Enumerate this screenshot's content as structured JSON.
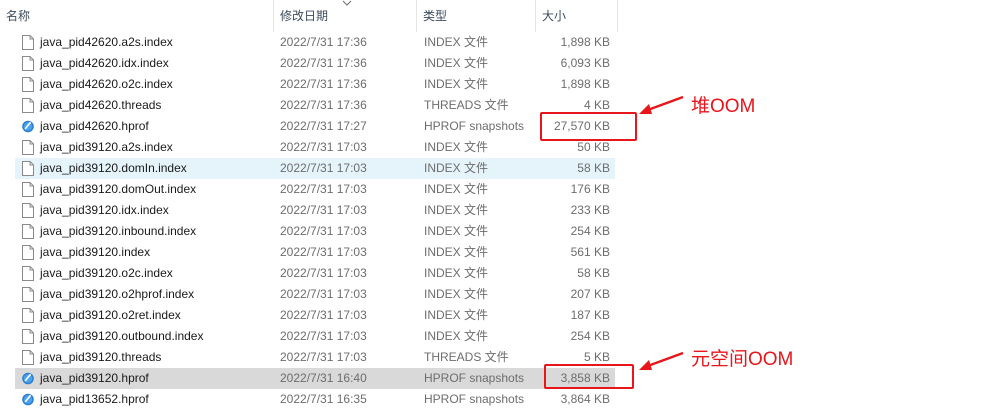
{
  "columns": {
    "name": "名称",
    "date": "修改日期",
    "type": "类型",
    "size": "大小"
  },
  "files": [
    {
      "name": "java_pid42620.a2s.index",
      "date": "2022/7/31 17:36",
      "type": "INDEX 文件",
      "size": "1,898 KB",
      "icon": "file-icon"
    },
    {
      "name": "java_pid42620.idx.index",
      "date": "2022/7/31 17:36",
      "type": "INDEX 文件",
      "size": "6,093 KB",
      "icon": "file-icon"
    },
    {
      "name": "java_pid42620.o2c.index",
      "date": "2022/7/31 17:36",
      "type": "INDEX 文件",
      "size": "1,898 KB",
      "icon": "file-icon"
    },
    {
      "name": "java_pid42620.threads",
      "date": "2022/7/31 17:36",
      "type": "THREADS 文件",
      "size": "4 KB",
      "icon": "file-icon"
    },
    {
      "name": "java_pid42620.hprof",
      "date": "2022/7/31 17:27",
      "type": "HPROF snapshots",
      "size": "27,570 KB",
      "icon": "hprof-icon"
    },
    {
      "name": "java_pid39120.a2s.index",
      "date": "2022/7/31 17:03",
      "type": "INDEX 文件",
      "size": "50 KB",
      "icon": "file-icon"
    },
    {
      "name": "java_pid39120.domIn.index",
      "date": "2022/7/31 17:03",
      "type": "INDEX 文件",
      "size": "58 KB",
      "icon": "file-icon"
    },
    {
      "name": "java_pid39120.domOut.index",
      "date": "2022/7/31 17:03",
      "type": "INDEX 文件",
      "size": "176 KB",
      "icon": "file-icon"
    },
    {
      "name": "java_pid39120.idx.index",
      "date": "2022/7/31 17:03",
      "type": "INDEX 文件",
      "size": "233 KB",
      "icon": "file-icon"
    },
    {
      "name": "java_pid39120.inbound.index",
      "date": "2022/7/31 17:03",
      "type": "INDEX 文件",
      "size": "254 KB",
      "icon": "file-icon"
    },
    {
      "name": "java_pid39120.index",
      "date": "2022/7/31 17:03",
      "type": "INDEX 文件",
      "size": "561 KB",
      "icon": "file-icon"
    },
    {
      "name": "java_pid39120.o2c.index",
      "date": "2022/7/31 17:03",
      "type": "INDEX 文件",
      "size": "58 KB",
      "icon": "file-icon"
    },
    {
      "name": "java_pid39120.o2hprof.index",
      "date": "2022/7/31 17:03",
      "type": "INDEX 文件",
      "size": "207 KB",
      "icon": "file-icon"
    },
    {
      "name": "java_pid39120.o2ret.index",
      "date": "2022/7/31 17:03",
      "type": "INDEX 文件",
      "size": "187 KB",
      "icon": "file-icon"
    },
    {
      "name": "java_pid39120.outbound.index",
      "date": "2022/7/31 17:03",
      "type": "INDEX 文件",
      "size": "254 KB",
      "icon": "file-icon"
    },
    {
      "name": "java_pid39120.threads",
      "date": "2022/7/31 17:03",
      "type": "THREADS 文件",
      "size": "5 KB",
      "icon": "file-icon"
    },
    {
      "name": "java_pid39120.hprof",
      "date": "2022/7/31 16:40",
      "type": "HPROF snapshots",
      "size": "3,858 KB",
      "icon": "hprof-icon"
    },
    {
      "name": "java_pid13652.hprof",
      "date": "2022/7/31 16:35",
      "type": "HPROF snapshots",
      "size": "3,864 KB",
      "icon": "hprof-icon"
    }
  ],
  "annotations": {
    "heap_oom": "堆OOM",
    "metaspace_oom": "元空间OOM"
  },
  "colors": {
    "annotation_red": "#e8151b",
    "hover_row": "#e5f3fb",
    "selected_row": "#d9d9d9"
  }
}
